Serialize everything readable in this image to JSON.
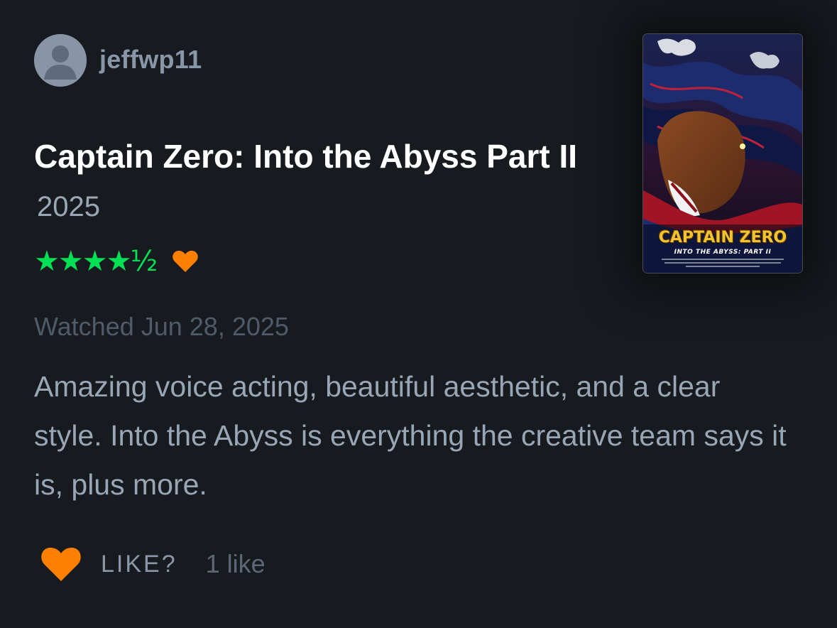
{
  "review": {
    "username": "jeffwp11",
    "film_title": "Captain Zero: Into the Abyss Part II",
    "year": "2025",
    "rating_stars": "★★★★½",
    "rating_value": 4.5,
    "liked": true,
    "watched_date": "Watched Jun 28, 2025",
    "body": "Amazing voice acting, beautiful aesthetic, and a clear style. Into the Abyss is everything the creative team says it is, plus more.",
    "like_prompt": "LIKE?",
    "like_count": "1 like"
  },
  "poster": {
    "title": "CAPTAIN ZERO",
    "subtitle": "INTO THE ABYSS: PART II"
  },
  "colors": {
    "background": "#14181c",
    "star_green": "#00e054",
    "heart_orange": "#ff8000",
    "muted_text": "#98a6b6"
  },
  "icons": {
    "avatar": "user-avatar-icon",
    "heart": "heart-icon"
  }
}
